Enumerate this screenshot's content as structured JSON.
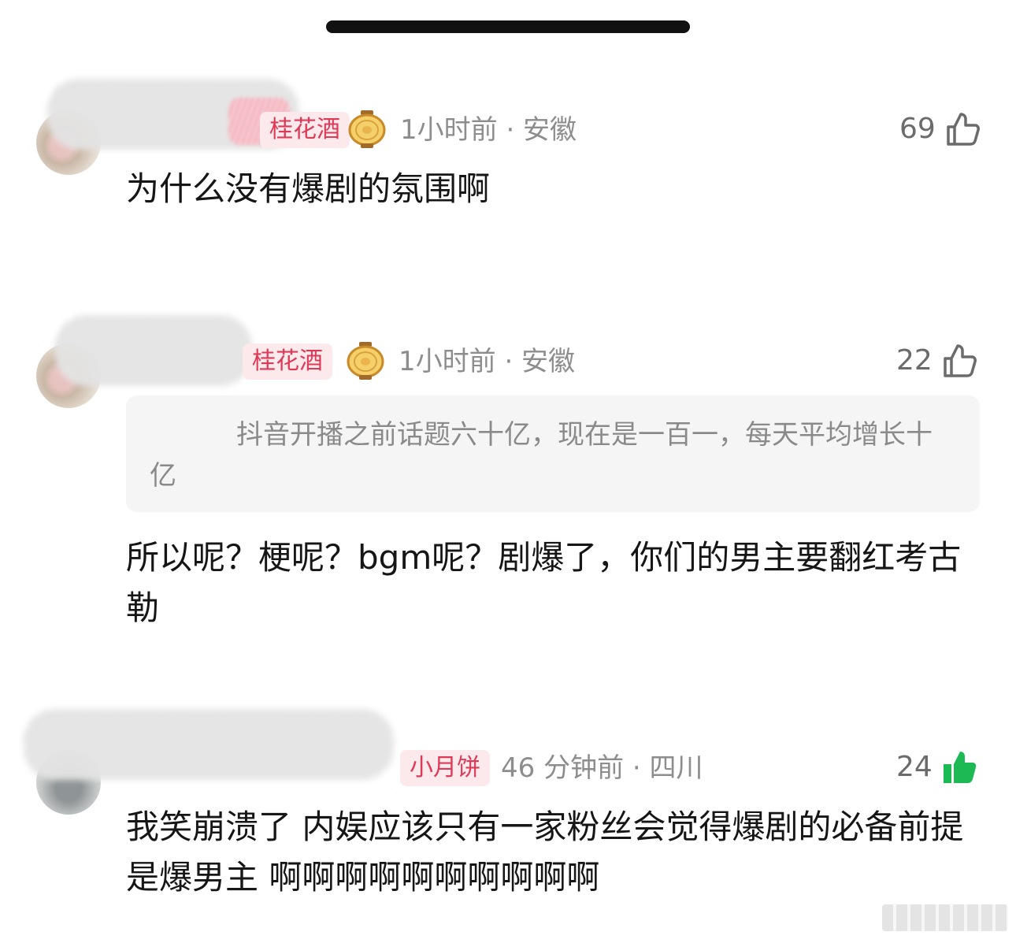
{
  "comments": [
    {
      "badge": "桂花酒",
      "time_location": "1小时前 · 安徽",
      "likes": "69",
      "text": "为什么没有爆剧的氛围啊",
      "liked": false
    },
    {
      "badge": "桂花酒",
      "time_location": "1小时前 · 安徽",
      "likes": "22",
      "quote": "抖音开播之前话题六十亿，现在是一百一，每天平均增长十亿",
      "text": "所以呢？梗呢？bgm呢？剧爆了，你们的男主要翻红考古勒",
      "liked": false
    },
    {
      "badge": "小月饼",
      "time_location": "46 分钟前 · 四川",
      "likes": "24",
      "text": "我笑崩溃了 内娱应该只有一家粉丝会觉得爆剧的必备前提是爆男主 啊啊啊啊啊啊啊啊啊啊",
      "liked": true
    }
  ],
  "colors": {
    "badge_text": "#de3a58",
    "badge_bg": "#fbe9ec",
    "liked_green": "#1db954",
    "meta_gray": "#8d8d8d"
  },
  "icons": [
    "thumbs-up-icon",
    "thumbs-up-filled-icon",
    "lantern-badge-icon"
  ]
}
